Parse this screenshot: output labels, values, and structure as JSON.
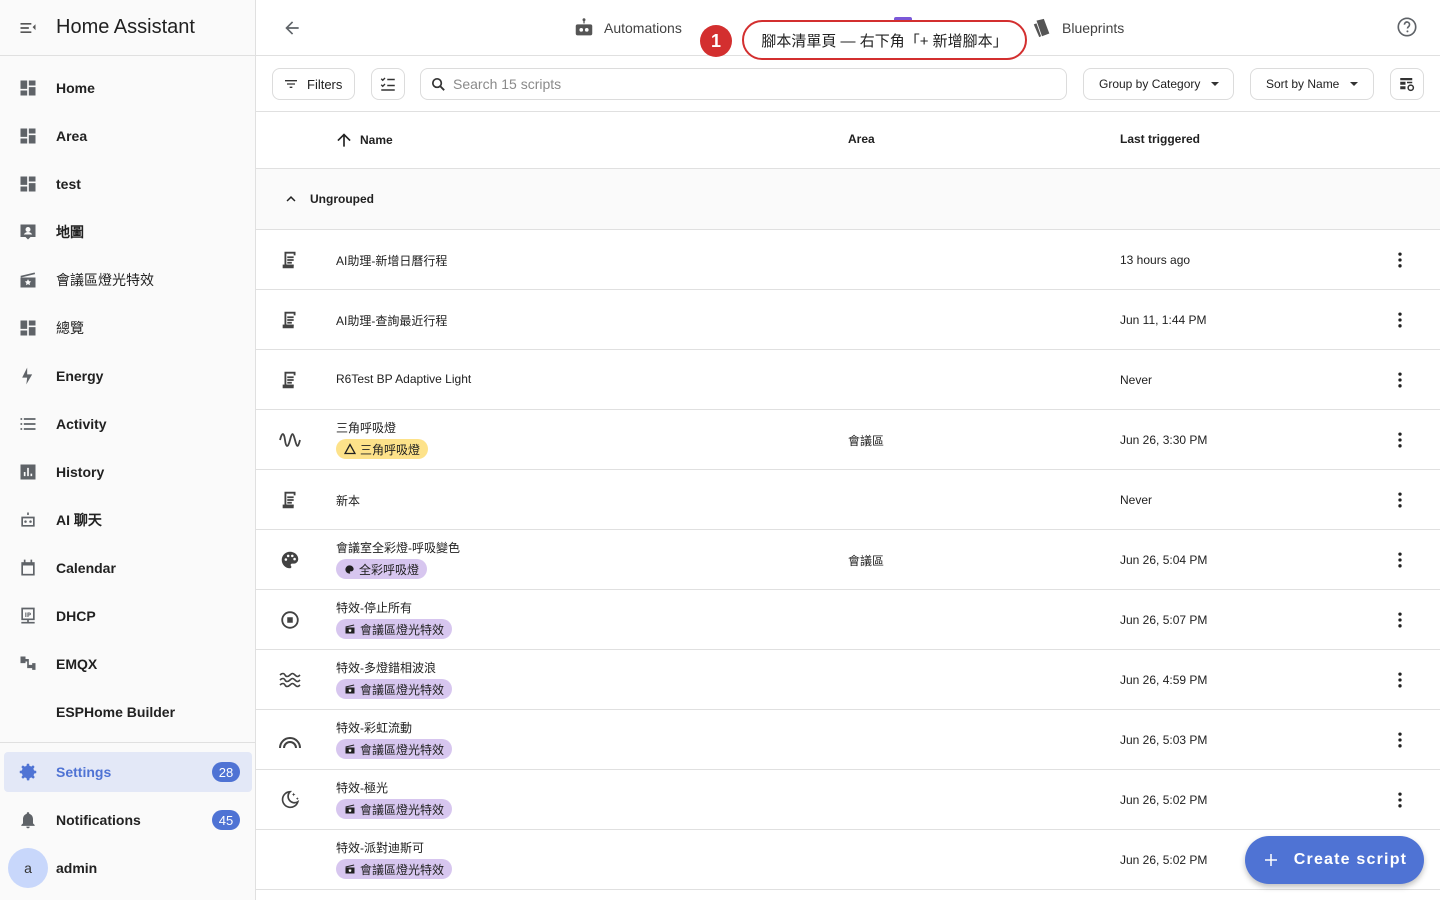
{
  "app": {
    "title": "Home Assistant"
  },
  "sidebar": {
    "items": [
      {
        "label": "Home"
      },
      {
        "label": "Area"
      },
      {
        "label": "test"
      },
      {
        "label": "地圖"
      },
      {
        "label": "會議區燈光特效"
      },
      {
        "label": "總覽"
      },
      {
        "label": "Energy"
      },
      {
        "label": "Activity"
      },
      {
        "label": "History"
      },
      {
        "label": "AI 聊天"
      },
      {
        "label": "Calendar"
      },
      {
        "label": "DHCP"
      },
      {
        "label": "EMQX"
      },
      {
        "label": "ESPHome Builder"
      }
    ],
    "settings": {
      "label": "Settings",
      "badge": "28"
    },
    "notifications": {
      "label": "Notifications",
      "badge": "45"
    },
    "user": {
      "initial": "a",
      "name": "admin"
    }
  },
  "topbar": {
    "tabs": [
      {
        "label": "Automations"
      },
      {
        "label": "Blueprints"
      }
    ]
  },
  "callout": {
    "number": "1",
    "text": "腳本清單頁 — 右下角「+ 新增腳本」"
  },
  "toolbar": {
    "filters_label": "Filters",
    "search_placeholder": "Search 15 scripts",
    "group_label": "Group by Category",
    "sort_label": "Sort by Name"
  },
  "table": {
    "columns": {
      "name": "Name",
      "area": "Area",
      "last_triggered": "Last triggered"
    },
    "group_label": "Ungrouped",
    "rows": [
      {
        "name": "AI助理-新增日曆行程",
        "area": "",
        "last": "13 hours ago",
        "icon": "script-icon",
        "chip": ""
      },
      {
        "name": "AI助理-查詢最近行程",
        "area": "",
        "last": "Jun 11, 1:44 PM",
        "icon": "script-icon",
        "chip": ""
      },
      {
        "name": "R6Test BP Adaptive Light",
        "area": "",
        "last": "Never",
        "icon": "script-icon",
        "chip": ""
      },
      {
        "name": "三角呼吸燈",
        "area": "會議區",
        "last": "Jun 26, 3:30 PM",
        "icon": "sine-wave-icon",
        "chip": "三角呼吸燈",
        "chip_color": "yellow",
        "chip_icon": "triangle"
      },
      {
        "name": "新本",
        "area": "",
        "last": "Never",
        "icon": "script-icon",
        "chip": ""
      },
      {
        "name": "會議室全彩燈-呼吸變色",
        "area": "會議區",
        "last": "Jun 26, 5:04 PM",
        "icon": "palette-icon",
        "chip": "全彩呼吸燈",
        "chip_color": "purple",
        "chip_icon": "palette"
      },
      {
        "name": "特效-停止所有",
        "area": "",
        "last": "Jun 26, 5:07 PM",
        "icon": "stop-circle-icon",
        "chip": "會議區燈光特效",
        "chip_color": "purple",
        "chip_icon": "clapper"
      },
      {
        "name": "特效-多燈錯相波浪",
        "area": "",
        "last": "Jun 26, 4:59 PM",
        "icon": "waves-icon",
        "chip": "會議區燈光特效",
        "chip_color": "purple",
        "chip_icon": "clapper"
      },
      {
        "name": "特效-彩虹流動",
        "area": "",
        "last": "Jun 26, 5:03 PM",
        "icon": "rainbow-icon",
        "chip": "會議區燈光特效",
        "chip_color": "purple",
        "chip_icon": "clapper"
      },
      {
        "name": "特效-極光",
        "area": "",
        "last": "Jun 26, 5:02 PM",
        "icon": "moon-star-icon",
        "chip": "會議區燈光特效",
        "chip_color": "purple",
        "chip_icon": "clapper"
      },
      {
        "name": "特效-派對迪斯可",
        "area": "",
        "last": "Jun 26, 5:02 PM",
        "icon": "",
        "chip": "會議區燈光特效",
        "chip_color": "purple",
        "chip_icon": "clapper"
      }
    ]
  },
  "fab": {
    "label": "Create script"
  },
  "colors": {
    "accent": "#4f73d4",
    "callout": "#d32f2f",
    "chip_yellow": "#fde28a",
    "chip_purple": "#d7c6ef"
  }
}
